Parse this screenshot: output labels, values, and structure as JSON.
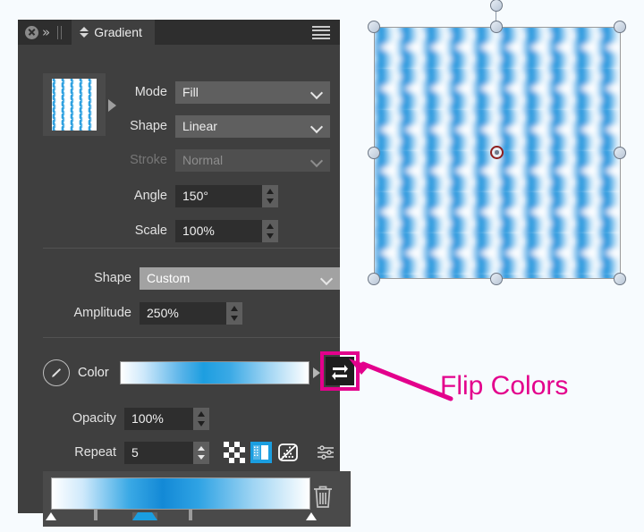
{
  "theme": {
    "panel_bg": "#3f3f3f",
    "titlebar_bg": "#2e2e2e",
    "accent_blue": "#1a9ee0",
    "annotation_magenta": "#e3008c",
    "canvas_bg": "#f7fbfe"
  },
  "titlebar": {
    "close_icon": "close-circle-icon",
    "expand_icon": "double-chevron-right-icon",
    "grip_icon": "grip-handle-icon",
    "tab_arrows_icon": "up-down-chevron-icon",
    "tab_label": "Gradient",
    "menu_icon": "hamburger-menu-icon"
  },
  "preview": {
    "thumbnail_name": "gradient-thumbnail",
    "expand_arrow_icon": "triangle-right-icon"
  },
  "fields": {
    "mode": {
      "label": "Mode",
      "value": "Fill",
      "type": "select",
      "disabled": false
    },
    "shape": {
      "label": "Shape",
      "value": "Linear",
      "type": "select",
      "disabled": false
    },
    "stroke": {
      "label": "Stroke",
      "value": "Normal",
      "type": "select",
      "disabled": true
    },
    "angle": {
      "label": "Angle",
      "value": "150°",
      "type": "stepper"
    },
    "scale": {
      "label": "Scale",
      "value": "100%",
      "type": "stepper"
    },
    "shape2": {
      "label": "Shape",
      "value": "Custom",
      "type": "select",
      "disabled": false
    },
    "amplitude": {
      "label": "Amplitude",
      "value": "250%",
      "type": "stepper"
    },
    "opacity": {
      "label": "Opacity",
      "value": "100%",
      "type": "stepper"
    },
    "repeat": {
      "label": "Repeat",
      "value": "5",
      "type": "stepper"
    }
  },
  "color_row": {
    "eyedropper_icon": "eyedropper-icon",
    "label": "Color",
    "swatch_name": "gradient-color-swatch",
    "expand_arrow_icon": "triangle-right-icon",
    "flip_button_icon": "flip-colors-icon",
    "flip_button_tooltip": "Flip Colors"
  },
  "repeat_modes": [
    {
      "name": "repeat-mode-tile-icon",
      "selected": false
    },
    {
      "name": "repeat-mode-mirror-icon",
      "selected": true
    },
    {
      "name": "repeat-mode-clamp-icon",
      "selected": false
    }
  ],
  "settings_icon": "sliders-settings-icon",
  "gradient_strip": {
    "name": "gradient-stops-strip",
    "delete_icon": "trash-icon",
    "stops": [
      {
        "position": 0,
        "kind": "triangle",
        "selected": false
      },
      {
        "position": 17,
        "kind": "tick",
        "selected": false
      },
      {
        "position": 34,
        "kind": "triangle",
        "selected": true
      },
      {
        "position": 55,
        "kind": "tick",
        "selected": false
      },
      {
        "position": 100,
        "kind": "triangle",
        "selected": false
      }
    ]
  },
  "canvas": {
    "artwork_name": "zigzag-gradient-artwork",
    "selection_handles": 8,
    "rotation_handle": "rotation-handle",
    "center_point": "gradient-center-point"
  },
  "annotation": {
    "text": "Flip Colors",
    "arrow_name": "annotation-arrow"
  }
}
